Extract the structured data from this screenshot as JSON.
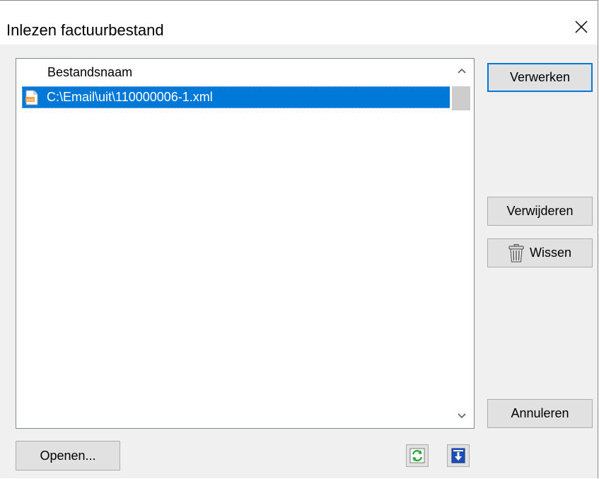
{
  "window": {
    "title": "Inlezen factuurbestand"
  },
  "list": {
    "column_header": "Bestandsnaam",
    "rows": [
      {
        "filename": "C:\\Email\\uit\\110000006-1.xml",
        "selected": true
      }
    ]
  },
  "buttons": {
    "verwerken": "Verwerken",
    "verwijderen": "Verwijderen",
    "wissen": "Wissen",
    "annuleren": "Annuleren",
    "openen": "Openen..."
  },
  "icons": {
    "close": "close-icon",
    "file": "xml-file-icon",
    "trash": "trash-icon",
    "refresh": "refresh-icon",
    "import": "import-icon"
  },
  "colors": {
    "selection": "#0078d7",
    "default_button_border": "#0078d7",
    "refresh_green": "#2aa63a",
    "import_blue": "#1d4fb8"
  }
}
